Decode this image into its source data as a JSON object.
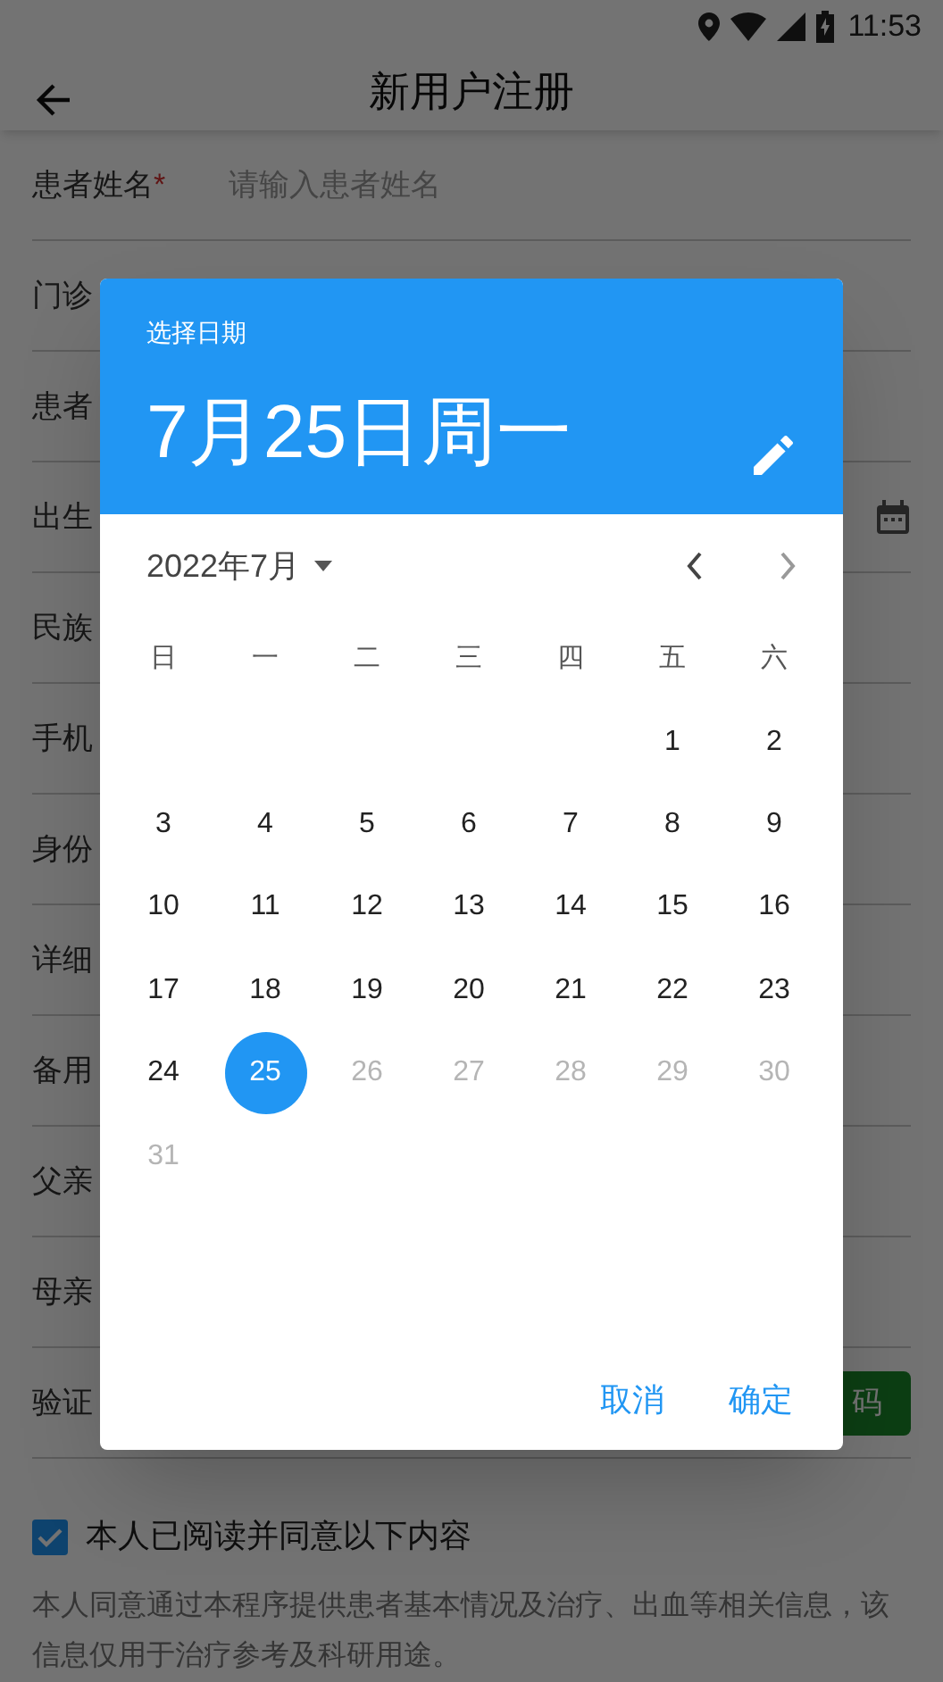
{
  "status_bar": {
    "time": "11:53"
  },
  "app_bar": {
    "title": "新用户注册"
  },
  "form": {
    "fields": [
      {
        "label": "患者姓名",
        "required_mark": "*",
        "placeholder": "请输入患者姓名",
        "kind": "text"
      },
      {
        "label": "门诊",
        "kind": "text"
      },
      {
        "label": "患者",
        "kind": "text"
      },
      {
        "label": "出生",
        "kind": "date"
      },
      {
        "label": "民族",
        "kind": "text"
      },
      {
        "label": "手机",
        "kind": "text"
      },
      {
        "label": "身份",
        "kind": "text"
      },
      {
        "label": "详细",
        "kind": "text"
      },
      {
        "label": "备用",
        "kind": "text"
      },
      {
        "label": "父亲",
        "kind": "text"
      },
      {
        "label": "母亲",
        "kind": "text"
      },
      {
        "label": "验证",
        "kind": "code",
        "button": "码"
      }
    ]
  },
  "consent": {
    "checked": true,
    "label": "本人已阅读并同意以下内容",
    "text": "本人同意通过本程序提供患者基本情况及治疗、出血等相关信息，该信息仅用于治疗参考及科研用途。"
  },
  "date_picker": {
    "header_label": "选择日期",
    "selected_date": "7月25日周一",
    "month": "2022年7月",
    "weekdays": [
      "日",
      "一",
      "二",
      "三",
      "四",
      "五",
      "六"
    ],
    "weeks": [
      [
        {
          "kind": "blank"
        },
        {
          "kind": "blank"
        },
        {
          "kind": "blank"
        },
        {
          "kind": "blank"
        },
        {
          "kind": "blank"
        },
        {
          "kind": "day",
          "day": "1",
          "selected": false,
          "disabled": false
        },
        {
          "kind": "day",
          "day": "2",
          "selected": false,
          "disabled": false
        }
      ],
      [
        {
          "kind": "day",
          "day": "3",
          "selected": false,
          "disabled": false
        },
        {
          "kind": "day",
          "day": "4",
          "selected": false,
          "disabled": false
        },
        {
          "kind": "day",
          "day": "5",
          "selected": false,
          "disabled": false
        },
        {
          "kind": "day",
          "day": "6",
          "selected": false,
          "disabled": false
        },
        {
          "kind": "day",
          "day": "7",
          "selected": false,
          "disabled": false
        },
        {
          "kind": "day",
          "day": "8",
          "selected": false,
          "disabled": false
        },
        {
          "kind": "day",
          "day": "9",
          "selected": false,
          "disabled": false
        }
      ],
      [
        {
          "kind": "day",
          "day": "10",
          "selected": false,
          "disabled": false
        },
        {
          "kind": "day",
          "day": "11",
          "selected": false,
          "disabled": false
        },
        {
          "kind": "day",
          "day": "12",
          "selected": false,
          "disabled": false
        },
        {
          "kind": "day",
          "day": "13",
          "selected": false,
          "disabled": false
        },
        {
          "kind": "day",
          "day": "14",
          "selected": false,
          "disabled": false
        },
        {
          "kind": "day",
          "day": "15",
          "selected": false,
          "disabled": false
        },
        {
          "kind": "day",
          "day": "16",
          "selected": false,
          "disabled": false
        }
      ],
      [
        {
          "kind": "day",
          "day": "17",
          "selected": false,
          "disabled": false
        },
        {
          "kind": "day",
          "day": "18",
          "selected": false,
          "disabled": false
        },
        {
          "kind": "day",
          "day": "19",
          "selected": false,
          "disabled": false
        },
        {
          "kind": "day",
          "day": "20",
          "selected": false,
          "disabled": false
        },
        {
          "kind": "day",
          "day": "21",
          "selected": false,
          "disabled": false
        },
        {
          "kind": "day",
          "day": "22",
          "selected": false,
          "disabled": false
        },
        {
          "kind": "day",
          "day": "23",
          "selected": false,
          "disabled": false
        }
      ],
      [
        {
          "kind": "day",
          "day": "24",
          "selected": false,
          "disabled": false
        },
        {
          "kind": "day",
          "day": "25",
          "selected": true,
          "disabled": false
        },
        {
          "kind": "day",
          "day": "26",
          "selected": false,
          "disabled": true
        },
        {
          "kind": "day",
          "day": "27",
          "selected": false,
          "disabled": true
        },
        {
          "kind": "day",
          "day": "28",
          "selected": false,
          "disabled": true
        },
        {
          "kind": "day",
          "day": "29",
          "selected": false,
          "disabled": true
        },
        {
          "kind": "day",
          "day": "30",
          "selected": false,
          "disabled": true
        }
      ],
      [
        {
          "kind": "day",
          "day": "31",
          "selected": false,
          "disabled": true
        }
      ]
    ],
    "buttons": [
      "取消",
      "确定"
    ]
  }
}
